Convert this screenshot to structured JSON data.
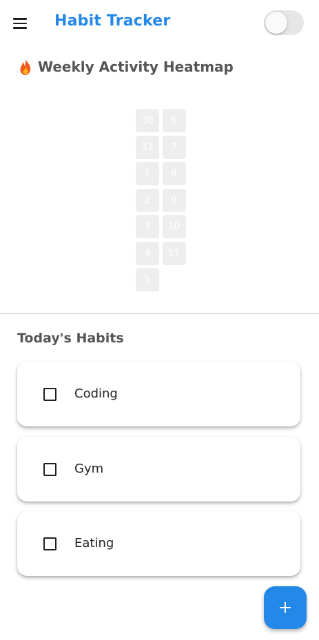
{
  "appbar": {
    "title": "Habit Tracker",
    "menu_icon": "hamburger-menu-icon",
    "toggle_state": "off"
  },
  "heatmap": {
    "icon": "fire-icon",
    "title": "Weekly Activity Heatmap",
    "days": [
      "30",
      "31",
      "1",
      "2",
      "3",
      "4",
      "5",
      "6",
      "7",
      "8",
      "9",
      "10",
      "11"
    ]
  },
  "habits": {
    "title": "Today's Habits",
    "items": [
      {
        "label": "Coding",
        "checked": false
      },
      {
        "label": "Gym",
        "checked": false
      },
      {
        "label": "Eating",
        "checked": false
      }
    ]
  },
  "fab": {
    "icon": "plus-icon"
  },
  "colors": {
    "accent": "#2388e8",
    "heatmap_cell": "#eeeeee",
    "heading_text": "#555555"
  }
}
